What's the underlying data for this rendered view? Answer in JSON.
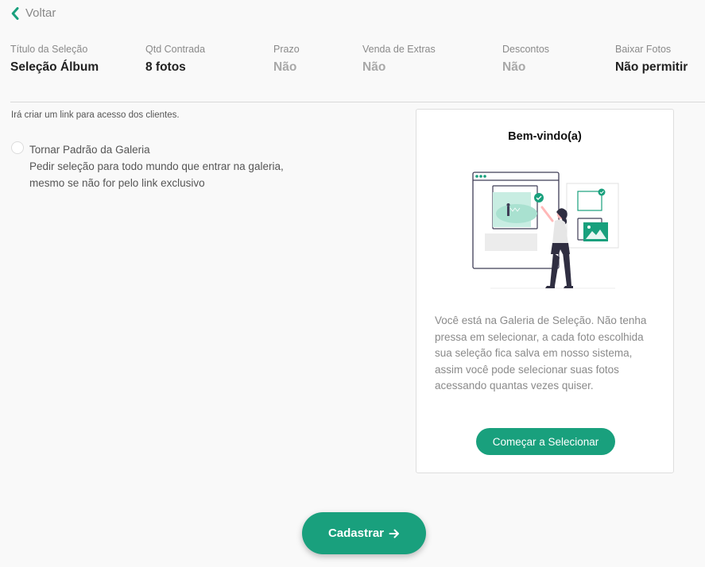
{
  "nav": {
    "back_label": "Voltar",
    "back_icon": "chevron-left-icon"
  },
  "summary": [
    {
      "label": "Título da Seleção",
      "value": "Seleção Álbum",
      "muted": false
    },
    {
      "label": "Qtd Contrada",
      "value": "8 fotos",
      "muted": false
    },
    {
      "label": "Prazo",
      "value": "Não",
      "muted": true
    },
    {
      "label": "Venda de Extras",
      "value": "Não",
      "muted": true
    },
    {
      "label": "Descontos",
      "value": "Não",
      "muted": true
    },
    {
      "label": "Baixar Fotos",
      "value": "Não permitir",
      "muted": false
    }
  ],
  "info_text": "Irá criar um link para acesso dos clientes.",
  "default_option": {
    "label": "Tornar Padrão da Galeria",
    "description_line1": "Pedir seleção para todo mundo que entrar na galeria,",
    "description_line2": "mesmo se não for pelo link exclusivo",
    "checked": false
  },
  "welcome_card": {
    "title": "Bem-vindo(a)",
    "description": "Você está na Galeria de Seleção. Não tenha pressa em selecionar, a cada foto escolhida sua seleção fica salva em nosso sistema, assim você pode selecionar suas fotos acessando quantas vezes quiser.",
    "button_label": "Começar a Selecionar",
    "illustration": "woman-selecting-photos-illustration"
  },
  "submit": {
    "label": "Cadastrar",
    "icon": "arrow-right-icon"
  },
  "colors": {
    "accent": "#19a07d",
    "muted_text": "#8a8a8a",
    "divider": "#d9d9d9"
  }
}
